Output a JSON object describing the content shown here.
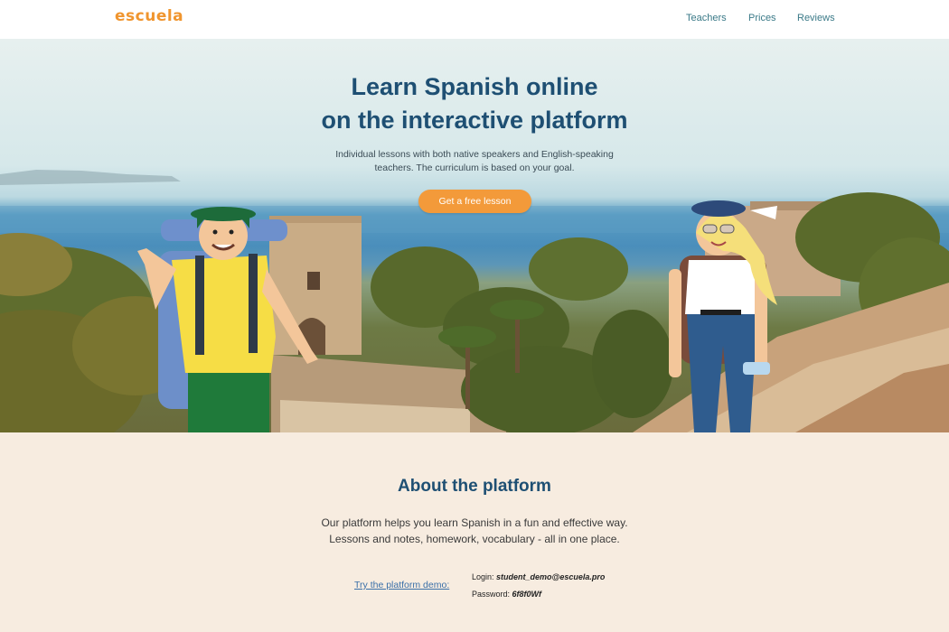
{
  "header": {
    "logo": "escuela",
    "nav": [
      "Teachers",
      "Prices",
      "Reviews"
    ]
  },
  "hero": {
    "title_line1": "Learn Spanish online",
    "title_line2": "on the interactive platform",
    "subtitle_line1": "Individual lessons with both native speakers and English-speaking",
    "subtitle_line2": "teachers. The curriculum is based on your goal.",
    "cta": "Get a free lesson"
  },
  "about": {
    "title": "About the platform",
    "text_line1": "Our platform helps you learn Spanish in a fun and effective way.",
    "text_line2": "Lessons and notes, homework, vocabulary - all in one place.",
    "demo_link": "Try the platform demo:",
    "login_label": "Login:",
    "login_value": "student_demo@escuela.pro",
    "password_label": "Password:",
    "password_value": "6f8f0Wf"
  },
  "colors": {
    "accent": "#f39a3a",
    "heading": "#1e4f73",
    "background": "#f7ece0"
  }
}
